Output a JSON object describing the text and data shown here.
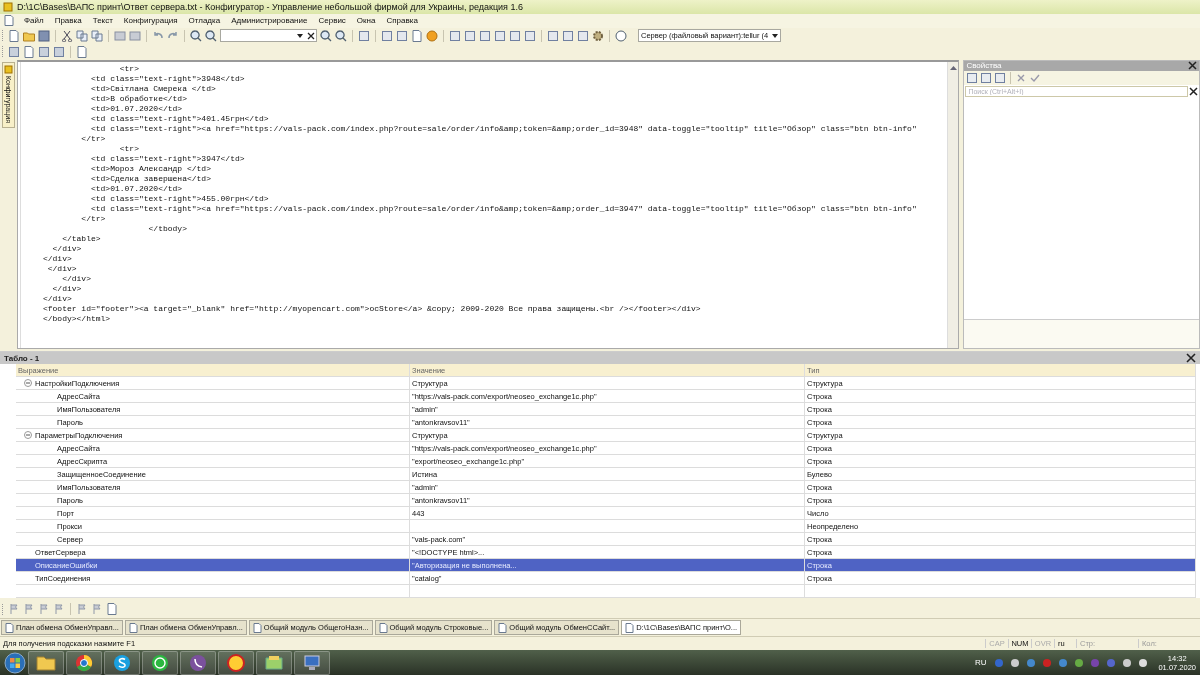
{
  "window": {
    "title": "D:\\1C\\Bases\\ВАПС принт\\Ответ сервера.txt - Конфигуратор - Управление небольшой фирмой для Украины, редакция 1.6"
  },
  "menu": [
    "Файл",
    "Правка",
    "Текст",
    "Конфигурация",
    "Отладка",
    "Администрирование",
    "Сервис",
    "Окна",
    "Справка"
  ],
  "toolbar": {
    "server": "Сервер (файловый вариант):tellur (4"
  },
  "left_tab": "Конфигурация",
  "editor": {
    "lines": [
      "                <tr>",
      "          <td class=\"text-right\">3948</td>",
      "          <td>Світлана Смерека </td>",
      "          <td>В обработке</td>",
      "          <td>01.07.2020</td>",
      "          <td class=\"text-right\">401.45грн</td>",
      "          <td class=\"text-right\"><a href=\"https://vals-pack.com/index.php?route=sale/order/info&amp;token=&amp;order_id=3948\" data-toggle=\"tooltip\" title=\"Обзор\" class=\"btn btn-info\"",
      "        </tr>",
      "                <tr>",
      "          <td class=\"text-right\">3947</td>",
      "          <td>Мороз Александр </td>",
      "          <td>Сделка завершена</td>",
      "          <td>01.07.2020</td>",
      "          <td class=\"text-right\">455.00грн</td>",
      "          <td class=\"text-right\"><a href=\"https://vals-pack.com/index.php?route=sale/order/info&amp;token=&amp;order_id=3947\" data-toggle=\"tooltip\" title=\"Обзор\" class=\"btn btn-info\"",
      "        </tr>",
      "                      </tbody>",
      "    </table>",
      "  </div>",
      "</div>",
      " </div>",
      "    </div>",
      "  </div>",
      "</div>",
      "<footer id=\"footer\"><a target=\"_blank\" href=\"http://myopencart.com\">ocStore</a> &copy; 2009-2020 Все права защищены.<br /></footer></div>",
      "</body></html>"
    ]
  },
  "properties": {
    "title": "Свойства",
    "search": {
      "placeholder": "Поиск (Ctrl+Alt+I)"
    }
  },
  "tablo": {
    "title": "Табло - 1",
    "columns": [
      "Выражение",
      "Значение",
      "Тип"
    ],
    "rows": [
      {
        "expression": "НастройкиПодключения",
        "value": "Структура",
        "type": "Структура",
        "selected": false,
        "expanded": true,
        "children": [
          {
            "expression": "АдресСайта",
            "value": "\"https://vals-pack.com/export/neoseo_exchange1c.php\"",
            "type": "Строка",
            "selected": false
          },
          {
            "expression": "ИмяПользователя",
            "value": "\"admin\"",
            "type": "Строка",
            "selected": false
          },
          {
            "expression": "Пароль",
            "value": "\"antonkravsov11\"",
            "type": "Строка",
            "selected": false
          }
        ]
      },
      {
        "expression": "ПараметрыПодключения",
        "value": "Структура",
        "type": "Структура",
        "selected": false,
        "expanded": true,
        "children": [
          {
            "expression": "АдресСайта",
            "value": "\"https://vals-pack.com/export/neoseo_exchange1c.php\"",
            "type": "Строка",
            "selected": false
          },
          {
            "expression": "АдресСкрипта",
            "value": "\"export/neoseo_exchange1c.php\"",
            "type": "Строка",
            "selected": false
          },
          {
            "expression": "ЗащищенноеСоединение",
            "value": "Истина",
            "type": "Булево",
            "selected": false
          },
          {
            "expression": "ИмяПользователя",
            "value": "\"admin\"",
            "type": "Строка",
            "selected": false
          },
          {
            "expression": "Пароль",
            "value": "\"antonkravsov11\"",
            "type": "Строка",
            "selected": false
          },
          {
            "expression": "Порт",
            "value": "443",
            "type": "Число",
            "selected": false
          },
          {
            "expression": "Прокси",
            "type": "Неопределено",
            "selected": false
          },
          {
            "expression": "Сервер",
            "value": "\"vals-pack.com\"",
            "type": "Строка",
            "selected": false
          }
        ]
      },
      {
        "expression": "ОтветСервера",
        "value": "\"<!DOCTYPE html>...",
        "type": "Строка",
        "selected": false
      },
      {
        "expression": "ОписаниеОшибки",
        "value": "\"Авторизация не выполнена...",
        "type": "Строка",
        "selected": true
      },
      {
        "expression": "ТипСоединения",
        "value": "\"catalog\"",
        "type": "Строка",
        "selected": false
      }
    ]
  },
  "window_tabs": [
    {
      "label": "План обмена ОбменУправл...",
      "selected": false
    },
    {
      "label": "План обмена ОбменУправл...",
      "selected": false
    },
    {
      "label": "Общий модуль ОбщегоНазн...",
      "selected": false
    },
    {
      "label": "Общий модуль Строковые...",
      "selected": false
    },
    {
      "label": "Общий модуль ОбменССайт...",
      "selected": false
    },
    {
      "label": "D:\\1C\\Bases\\ВАПС принт\\О...",
      "selected": true
    }
  ],
  "status_bar": {
    "hint": "Для получения подсказки нажмите F1",
    "indicators": [
      {
        "label": "CAP",
        "on": false
      },
      {
        "label": "NUM",
        "on": true
      },
      {
        "label": "OVR",
        "on": false
      }
    ],
    "language": "ru",
    "line": "Стр:",
    "column": "Кол:"
  },
  "taskbar": {
    "language": "RU",
    "time": "14:32",
    "date": "01.07.2020"
  }
}
